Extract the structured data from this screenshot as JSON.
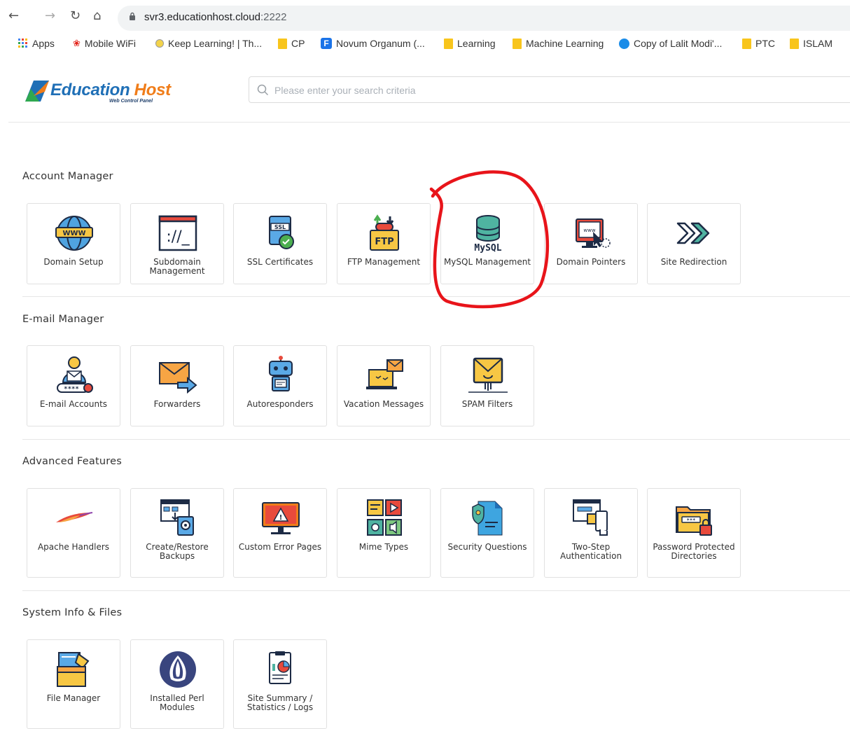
{
  "browser": {
    "url_host": "svr3.educationhost.cloud",
    "url_port": ":2222",
    "bookmarks": [
      {
        "label": "Apps",
        "icon": "apps-grid-icon"
      },
      {
        "label": "Mobile WiFi",
        "icon": "huawei-icon"
      },
      {
        "label": "Keep Learning! | Th...",
        "icon": "site-icon"
      },
      {
        "label": "CP",
        "icon": "folder-icon"
      },
      {
        "label": "Novum Organum (...",
        "icon": "f-icon"
      },
      {
        "label": "Learning",
        "icon": "folder-icon"
      },
      {
        "label": "Machine Learning",
        "icon": "folder-icon"
      },
      {
        "label": "Copy of Lalit Modi'...",
        "icon": "globe-dot-icon"
      },
      {
        "label": "PTC",
        "icon": "folder-icon"
      },
      {
        "label": "ISLAM",
        "icon": "folder-icon"
      }
    ]
  },
  "header": {
    "brand_main": "Education",
    "brand_accent": " Host",
    "brand_sub": "Web Control Panel",
    "search_placeholder": "Please enter your search criteria"
  },
  "sections": [
    {
      "title": "Account Manager",
      "items": [
        {
          "label": "Domain Setup",
          "icon": "www-globe-icon"
        },
        {
          "label": "Subdomain Management",
          "icon": "subdomain-icon"
        },
        {
          "label": "SSL Certificates",
          "icon": "ssl-certificate-icon"
        },
        {
          "label": "FTP Management",
          "icon": "ftp-icon"
        },
        {
          "label": "MySQL Management",
          "icon": "mysql-database-icon",
          "icon_text": "MySQL"
        },
        {
          "label": "Domain Pointers",
          "icon": "domain-pointer-icon"
        },
        {
          "label": "Site Redirection",
          "icon": "redirect-arrows-icon"
        }
      ]
    },
    {
      "title": "E-mail Manager",
      "items": [
        {
          "label": "E-mail Accounts",
          "icon": "email-account-icon"
        },
        {
          "label": "Forwarders",
          "icon": "forward-mail-icon"
        },
        {
          "label": "Autoresponders",
          "icon": "robot-icon"
        },
        {
          "label": "Vacation Messages",
          "icon": "vacation-laptop-icon"
        },
        {
          "label": "SPAM Filters",
          "icon": "spam-filter-icon"
        }
      ]
    },
    {
      "title": "Advanced Features",
      "items": [
        {
          "label": "Apache Handlers",
          "icon": "apache-feather-icon"
        },
        {
          "label": "Create/Restore Backups",
          "icon": "backup-disk-icon"
        },
        {
          "label": "Custom Error Pages",
          "icon": "error-monitor-icon"
        },
        {
          "label": "Mime Types",
          "icon": "mime-types-icon"
        },
        {
          "label": "Security Questions",
          "icon": "security-doc-icon"
        },
        {
          "label": "Two-Step Authentication",
          "icon": "two-step-auth-icon"
        },
        {
          "label": "Password Protected Directories",
          "icon": "locked-folder-icon"
        }
      ]
    },
    {
      "title": "System Info & Files",
      "items": [
        {
          "label": "File Manager",
          "icon": "file-manager-icon"
        },
        {
          "label": "Installed Perl Modules",
          "icon": "perl-onion-icon"
        },
        {
          "label": "Site Summary / Statistics / Logs",
          "icon": "site-summary-icon"
        }
      ]
    }
  ],
  "colors": {
    "brand_blue": "#1f6fb6",
    "brand_orange": "#f07d1a",
    "annotation_red": "#e8141a"
  }
}
